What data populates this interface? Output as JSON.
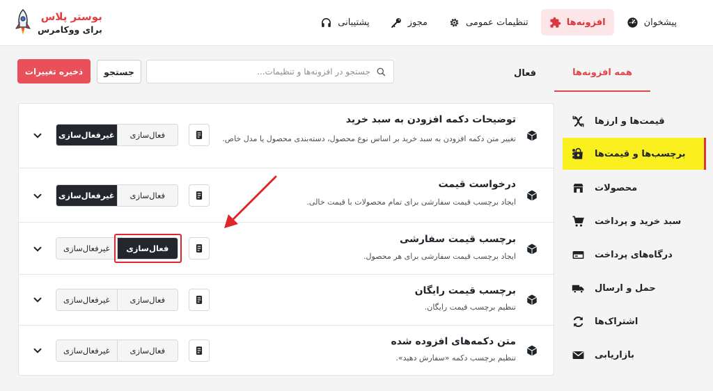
{
  "brand": {
    "name": "بوستر پلاس",
    "subtitle": "برای ووکامرس"
  },
  "topnav": [
    {
      "label": "پیشخوان",
      "icon": "dashboard-icon"
    },
    {
      "label": "افزونه‌ها",
      "icon": "puzzle-icon",
      "active": true
    },
    {
      "label": "تنظیمات عمومی",
      "icon": "gear-icon"
    },
    {
      "label": "مجوز",
      "icon": "key-icon"
    },
    {
      "label": "پشتیبانی",
      "icon": "headset-icon"
    }
  ],
  "tabs": [
    {
      "label": "همه افزونه‌ها",
      "active": true
    },
    {
      "label": "فعال"
    }
  ],
  "search": {
    "placeholder": "جستجو در افزونه‌ها و تنظیمات...",
    "value": "",
    "button_label": "جستجو"
  },
  "save_button": "ذخیره تغییرات",
  "sidebar": [
    {
      "label": "قیمت‌ها و ارزها",
      "icon": "currency-exchange-icon"
    },
    {
      "label": "برچسب‌ها و قیمت‌ها",
      "icon": "tag-bag-icon",
      "active": true
    },
    {
      "label": "محصولات",
      "icon": "store-box-icon"
    },
    {
      "label": "سبد خرید و پرداخت",
      "icon": "cart-icon"
    },
    {
      "label": "درگاه‌های پرداخت",
      "icon": "card-icon"
    },
    {
      "label": "حمل و ارسال",
      "icon": "truck-icon"
    },
    {
      "label": "اشتراک‌ها",
      "icon": "refresh-icon"
    },
    {
      "label": "بازاریابی",
      "icon": "mail-icon"
    }
  ],
  "features": [
    {
      "title": "توضیحات دکمه افزودن به سبد خرید",
      "description": "تغییر متن دکمه افزودن به سبد خرید بر اساس نوع محصول، دسته‌بندی محصول یا مدل خاص.",
      "state": "inactive"
    },
    {
      "title": "درخواست قیمت",
      "description": "ایجاد برچسب قیمت سفارشی برای تمام محصولات با قیمت خالی.",
      "state": "inactive"
    },
    {
      "title": "برچسب قیمت سفارشی",
      "description": "ایجاد برچسب قیمت سفارشی برای هر محصول.",
      "state": "active"
    },
    {
      "title": "برچسب قیمت رایگان",
      "description": "تنظیم برچسب قیمت رایگان.",
      "state": "none"
    },
    {
      "title": "متن دکمه‌های افزوده شده",
      "description": "تنظیم برچسب دکمه «سفارش دهید».",
      "state": "none"
    }
  ],
  "toggle_labels": {
    "activate": "فعال‌سازی",
    "deactivate": "غیرفعال‌سازی"
  },
  "colors": {
    "accent": "#e0474c",
    "highlight": "#fbf01f",
    "dark_button": "#23272d",
    "save_button": "#e9505a"
  }
}
